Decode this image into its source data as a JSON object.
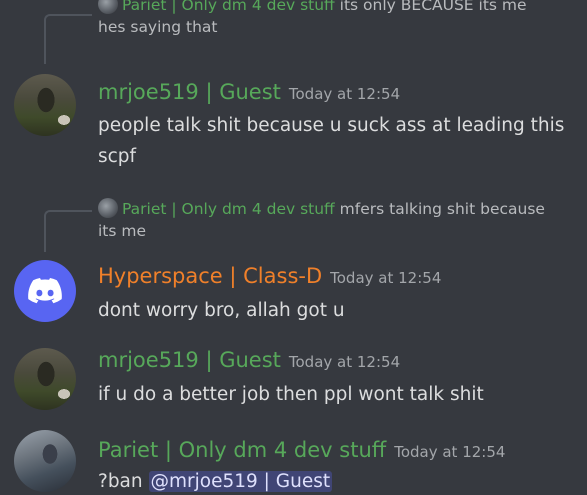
{
  "colors": {
    "background": "#36393f",
    "guest_name": "#57a85a",
    "classd_name": "#f0802a",
    "pariet_name": "#57a85a",
    "mention_bg": "#5865f2"
  },
  "messages": [
    {
      "reply": {
        "name": "Pariet | Only dm 4 dev stuff",
        "text_line1": "its only BECAUSE its me",
        "text_line2": "hes saying that"
      },
      "author": "mrjoe519 | Guest",
      "timestamp": "Today at 12:54",
      "text_line1": "people talk shit because u suck ass at leading this",
      "text_line2": "scpf"
    },
    {
      "reply": {
        "name": "Pariet | Only dm 4 dev stuff",
        "text_line1": "mfers talking shit because",
        "text_line2": "its me"
      },
      "author": "Hyperspace | Class-D",
      "timestamp": "Today at 12:54",
      "text": "dont worry bro, allah got u"
    },
    {
      "author": "mrjoe519 | Guest",
      "timestamp": "Today at 12:54",
      "text": "if u do a better job then ppl wont talk shit"
    },
    {
      "author": "Pariet | Only dm 4 dev stuff",
      "timestamp": "Today at 12:54",
      "text_prefix": "?ban",
      "mention": "@mrjoe519 | Guest"
    }
  ]
}
